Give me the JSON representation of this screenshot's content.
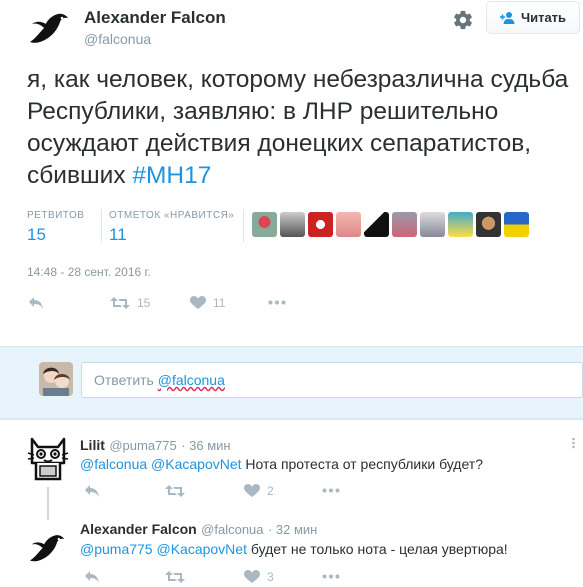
{
  "tweet": {
    "author_name": "Alexander Falcon",
    "author_handle": "@falconua",
    "follow_label": "Читать",
    "text": "я, как человек, которому небезразлична судьба Республики, заявляю: в ЛНР решительно осуждают действия донецких сепаратистов, сбивших ",
    "hashtag": "#МН17",
    "retweets_label": "РЕТВИТОВ",
    "retweets_count": "15",
    "likes_label": "ОТМЕТОК «НРАВИТСЯ»",
    "likes_count": "11",
    "timestamp": "14:48 - 28 сент. 2016 г.",
    "action_retweet_count": "15",
    "action_like_count": "11"
  },
  "composer": {
    "prefix": "Ответить ",
    "mention": "@falconua"
  },
  "replies": [
    {
      "name": "Lilit",
      "handle": "@puma775",
      "time": "· 36 мин",
      "mention1": "@falconua",
      "mention2": "@KacapovNet",
      "text": " Нота протеста от республики будет?",
      "like_count": "2"
    },
    {
      "name": "Alexander Falcon",
      "handle": "@falconua",
      "time": "· 32 мин",
      "mention1": "@puma775",
      "mention2": "@KacapovNet",
      "text": " будет не только нота - целая увертюра!",
      "like_count": "3"
    }
  ],
  "colors": {
    "link": "#1c94e0",
    "muted": "#8899a6",
    "composer_bg": "#e8f4fb"
  },
  "icons": [
    "falcon-avatar",
    "gear-icon",
    "follow-person-icon",
    "reply-icon",
    "retweet-icon",
    "heart-icon",
    "more-icon",
    "cat-avatar"
  ]
}
